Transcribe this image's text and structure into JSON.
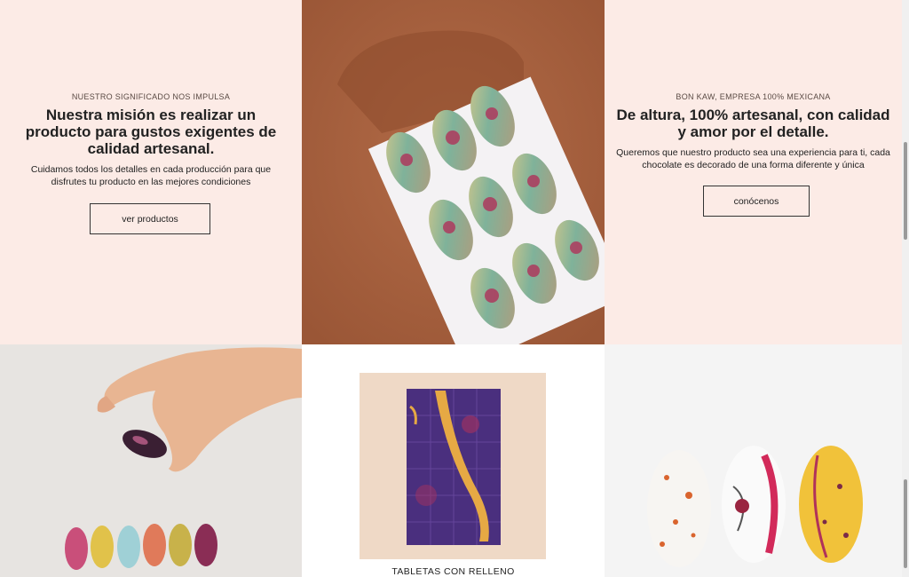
{
  "mission": {
    "eyebrow": "NUESTRO SIGNIFICADO NOS IMPULSA",
    "headline": "Nuestra misión es realizar un producto para gustos exigentes de calidad artesanal.",
    "body": "Cuidamos todos los detalles en cada producción para que disfrutes tu producto en las mejores condiciones",
    "button_label": "ver productos"
  },
  "about": {
    "eyebrow": "BON KAW, EMPRESA 100% MEXICANA",
    "headline": "De altura, 100% artesanal, con calidad y amor por el detalle.",
    "body": "Queremos que nuestro producto sea una experiencia para ti, cada chocolate es decorado de una forma diferente y única",
    "button_label": "conócenos"
  },
  "tablets": {
    "label": "TABLETAS CON RELLENO"
  },
  "colors": {
    "panel_bg": "#fcebe6",
    "cocoa": "#a8623f"
  }
}
